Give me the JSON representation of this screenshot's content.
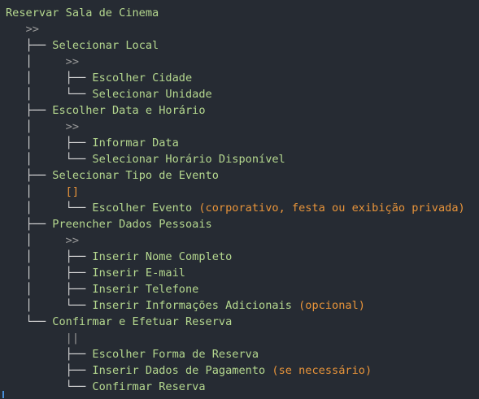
{
  "colors": {
    "background": "#262b33",
    "label": "#b5d88f",
    "tree_guide": "#dcdcdc",
    "operator": "#9a9a9a",
    "optional_operator": "#e8943a",
    "paren": "#e8943a",
    "caret": "#4a8fd8"
  },
  "lines": [
    {
      "kind": "label",
      "indent": "",
      "text": "Reservar Sala de Cinema"
    },
    {
      "kind": "op",
      "indent": "   ",
      "text": ">>",
      "op_class": "op-seq"
    },
    {
      "kind": "label",
      "indent": "   ├── ",
      "text": "Selecionar Local"
    },
    {
      "kind": "op",
      "indent": "   │     ",
      "text": ">>",
      "op_class": "op-seq"
    },
    {
      "kind": "label",
      "indent": "   │     ├── ",
      "text": "Escolher Cidade"
    },
    {
      "kind": "label",
      "indent": "   │     └── ",
      "text": "Selecionar Unidade"
    },
    {
      "kind": "label",
      "indent": "   ├── ",
      "text": "Escolher Data e Horário"
    },
    {
      "kind": "op",
      "indent": "   │     ",
      "text": ">>",
      "op_class": "op-seq"
    },
    {
      "kind": "label",
      "indent": "   │     ├── ",
      "text": "Informar Data"
    },
    {
      "kind": "label",
      "indent": "   │     └── ",
      "text": "Selecionar Horário Disponível"
    },
    {
      "kind": "label",
      "indent": "   ├── ",
      "text": "Selecionar Tipo de Evento"
    },
    {
      "kind": "op",
      "indent": "   │     ",
      "text": "[]",
      "op_class": "op-opt"
    },
    {
      "kind": "label-paren",
      "indent": "   │     └── ",
      "text": "Escolher Evento ",
      "paren": "(corporativo, festa ou exibição privada)"
    },
    {
      "kind": "label",
      "indent": "   ├── ",
      "text": "Preencher Dados Pessoais"
    },
    {
      "kind": "op",
      "indent": "   │     ",
      "text": ">>",
      "op_class": "op-seq"
    },
    {
      "kind": "label",
      "indent": "   │     ├── ",
      "text": "Inserir Nome Completo"
    },
    {
      "kind": "label",
      "indent": "   │     ├── ",
      "text": "Inserir E-mail"
    },
    {
      "kind": "label",
      "indent": "   │     ├── ",
      "text": "Inserir Telefone"
    },
    {
      "kind": "label-paren",
      "indent": "   │     └── ",
      "text": "Inserir Informações Adicionais ",
      "paren": "(opcional)"
    },
    {
      "kind": "label",
      "indent": "   └── ",
      "text": "Confirmar e Efetuar Reserva"
    },
    {
      "kind": "op",
      "indent": "         ",
      "text": "||",
      "op_class": "op-par"
    },
    {
      "kind": "label",
      "indent": "         ├── ",
      "text": "Escolher Forma de Reserva"
    },
    {
      "kind": "label-paren",
      "indent": "         ├── ",
      "text": "Inserir Dados de Pagamento ",
      "paren": "(se necessário)"
    },
    {
      "kind": "label",
      "indent": "         └── ",
      "text": "Confirmar Reserva"
    }
  ]
}
